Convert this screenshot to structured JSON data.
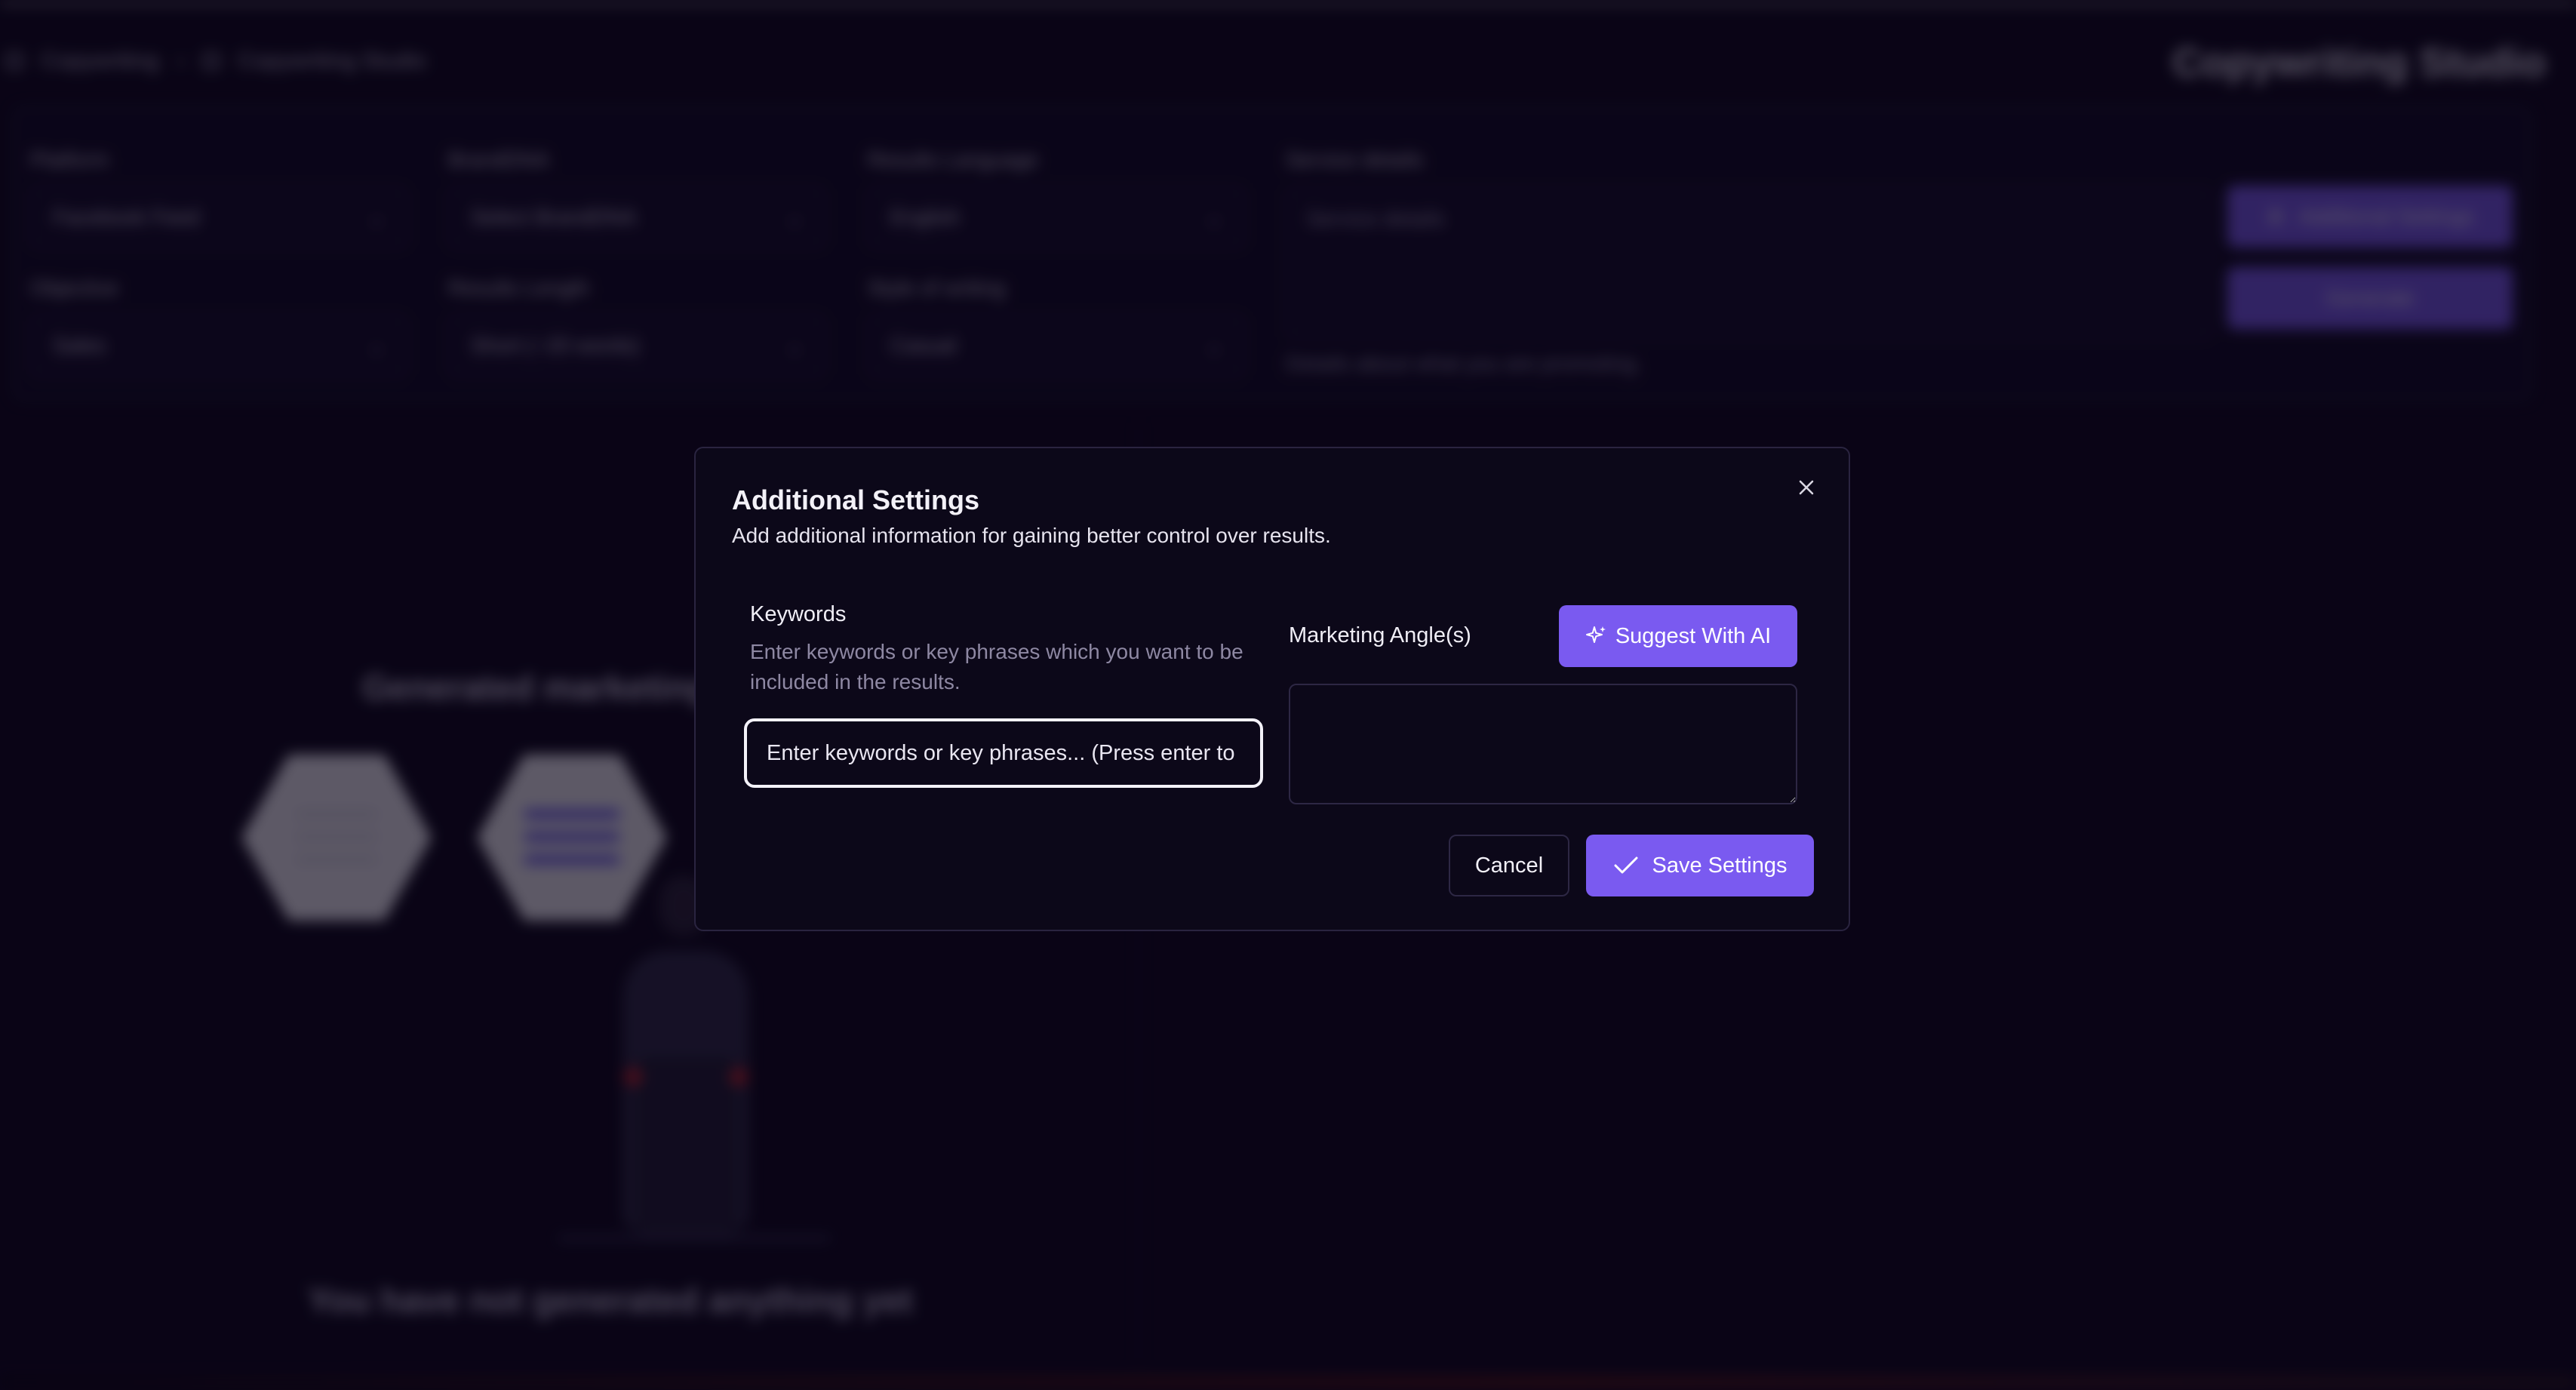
{
  "background": {
    "breadcrumb": [
      "Copywriting",
      "Copywriting Studio"
    ],
    "page_title": "Copywriting Studio",
    "fields": [
      {
        "label": "Platform",
        "value": "Facebook Feed"
      },
      {
        "label": "BrandDNA",
        "value": "Select BrandDNA"
      },
      {
        "label": "Results Language",
        "value": "English"
      },
      {
        "label": "Objective",
        "value": "Sales"
      },
      {
        "label": "Results Length",
        "value": "Short (~20 words)"
      },
      {
        "label": "Style of writing",
        "value": "Casual"
      }
    ],
    "service": {
      "label": "Service details",
      "placeholder": "Service details",
      "help": "Details about what you are promoting."
    },
    "additional_settings_label": "Additional Settings",
    "generate_label": "Generate",
    "empty_heading": "Generated marketing a",
    "empty_text": "You have not generated anything yet"
  },
  "modal": {
    "title": "Additional Settings",
    "description": "Add additional information for gaining better control over results.",
    "keywords": {
      "label": "Keywords",
      "help": "Enter keywords or key phrases which you want to be included in the results.",
      "placeholder": "Enter keywords or key phrases... (Press enter to add)"
    },
    "marketing_angles": {
      "label": "Marketing Angle(s)",
      "suggest_label": "Suggest With AI"
    },
    "cancel_label": "Cancel",
    "save_label": "Save Settings"
  },
  "colors": {
    "accent": "#7a5af0",
    "background": "#0b0618",
    "modal_bg": "#0c0819"
  },
  "icons": {
    "close": "close-icon",
    "sparkle": "sparkle-icon",
    "check": "check-icon"
  }
}
